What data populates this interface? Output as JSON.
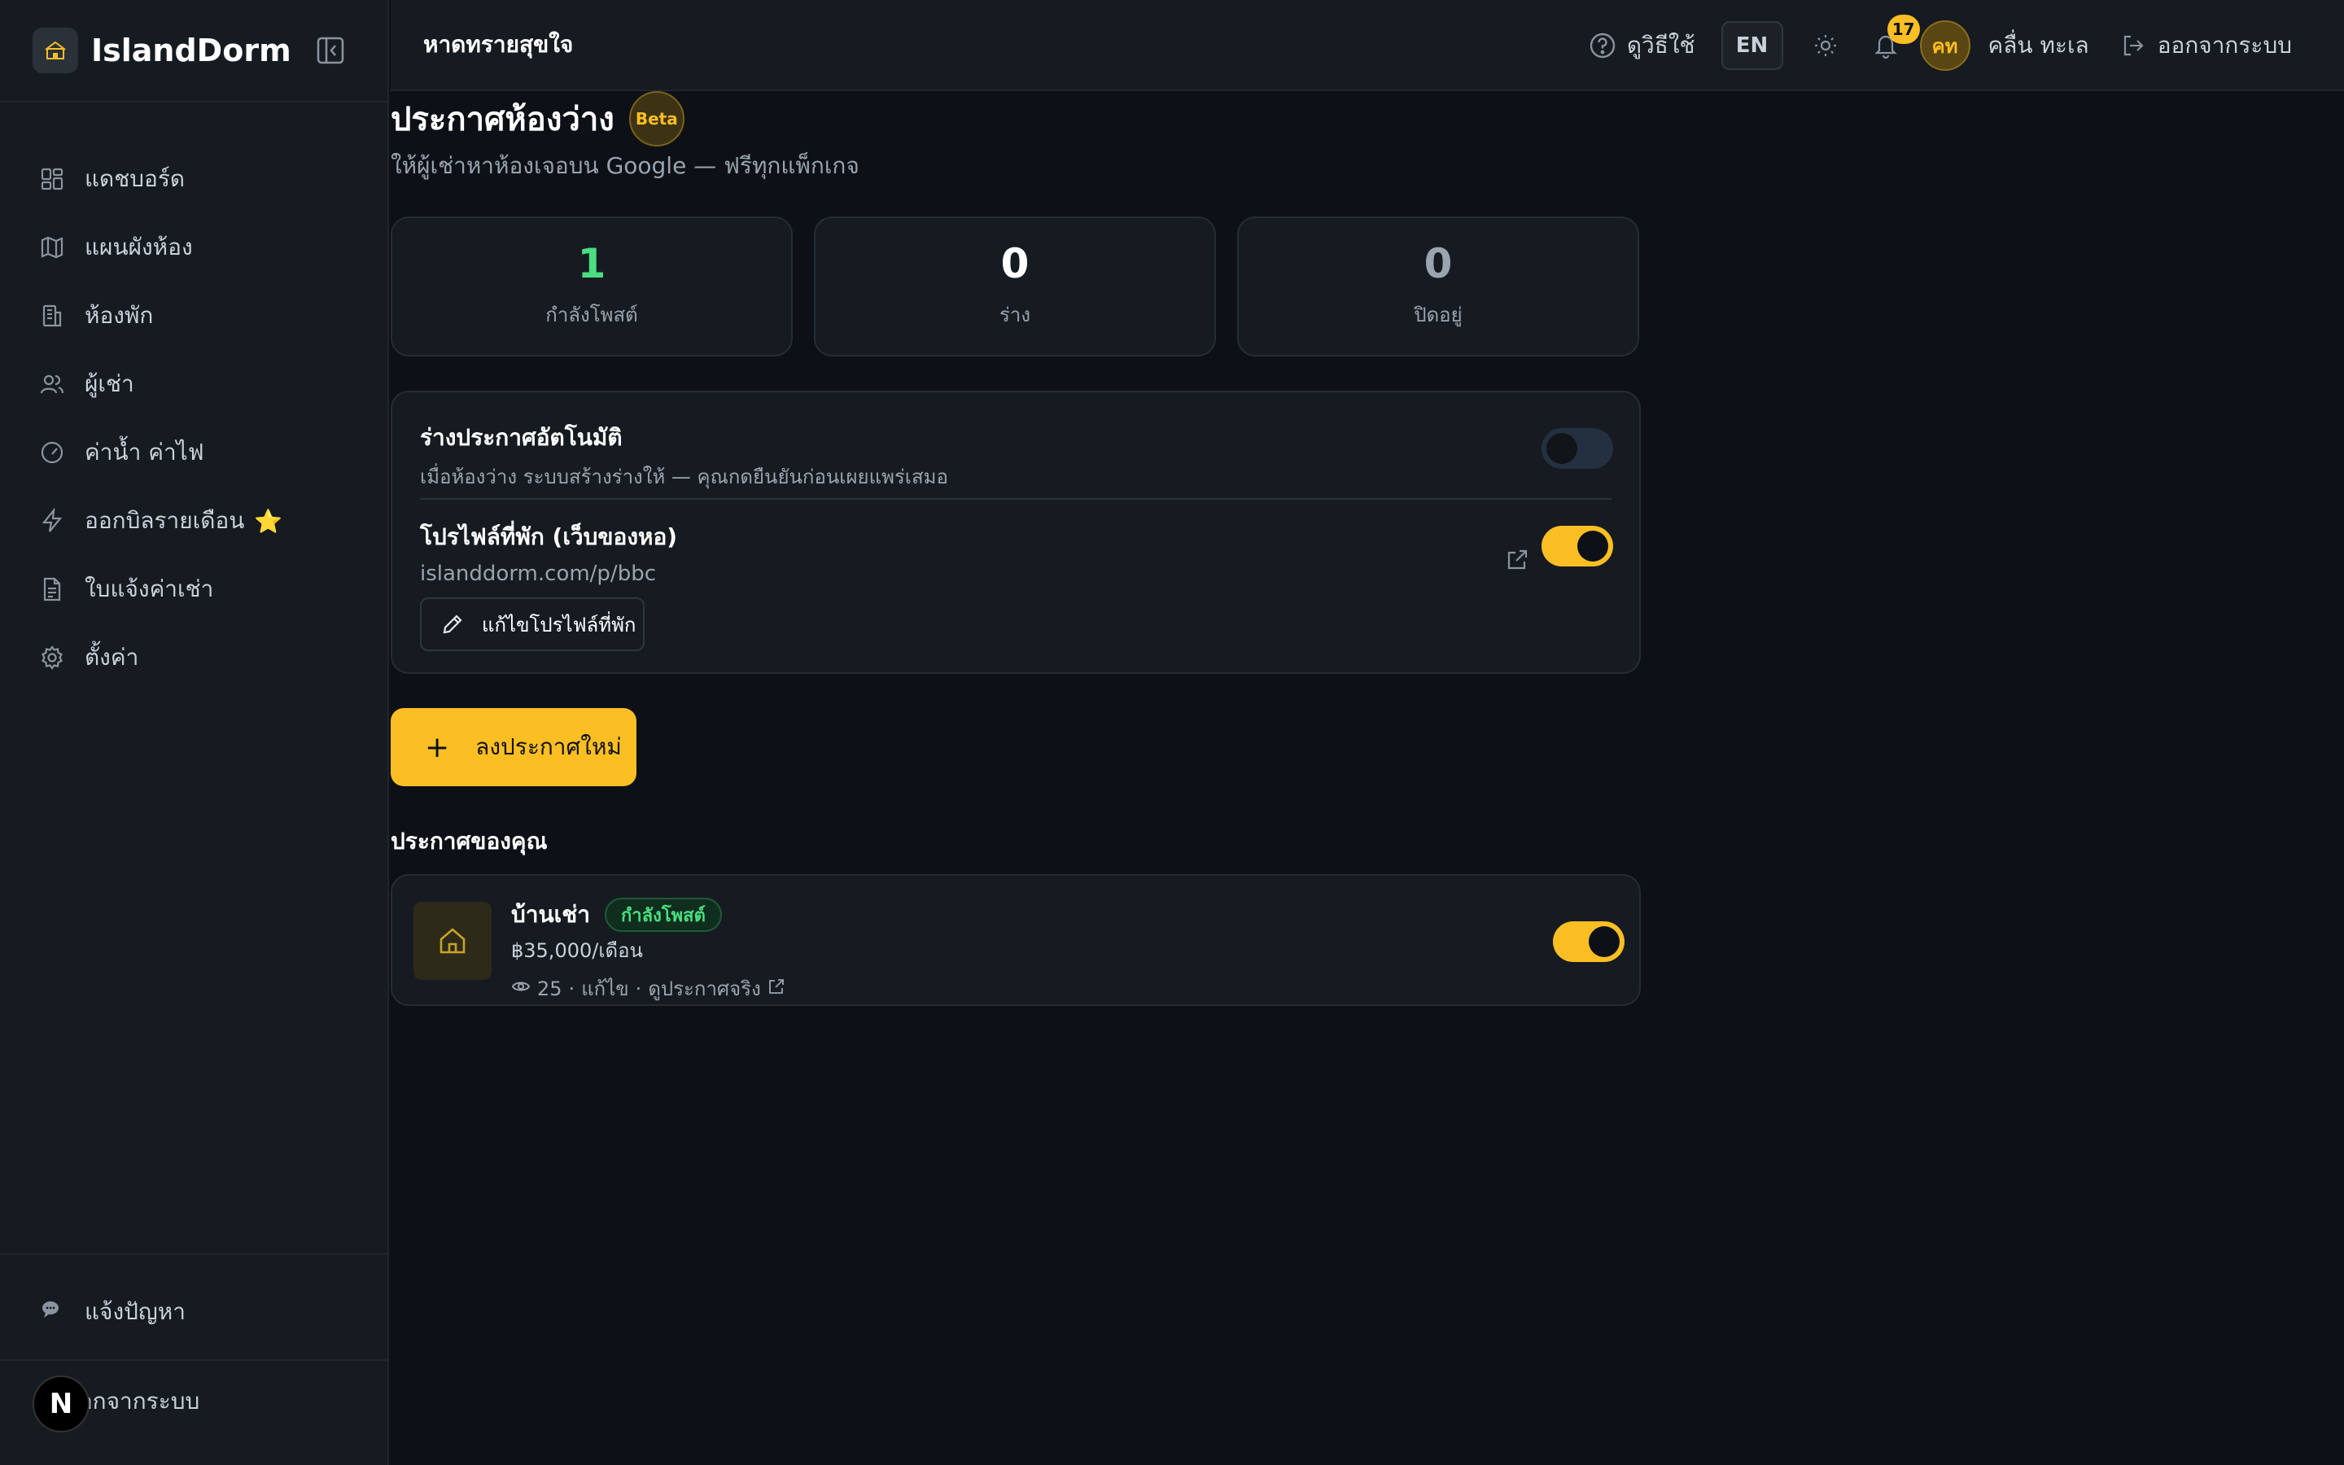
{
  "app": {
    "name": "IslandDorm"
  },
  "sidebar": {
    "items": [
      {
        "label": "แดชบอร์ด",
        "icon": "dashboard-icon"
      },
      {
        "label": "แผนผังห้อง",
        "icon": "map-icon"
      },
      {
        "label": "ห้องพัก",
        "icon": "building-icon"
      },
      {
        "label": "ผู้เช่า",
        "icon": "users-icon"
      },
      {
        "label": "ค่าน้ำ ค่าไฟ",
        "icon": "gauge-icon"
      },
      {
        "label": "ออกบิลรายเดือน",
        "icon": "lightning-icon"
      },
      {
        "label": "ใบแจ้งค่าเช่า",
        "icon": "document-icon"
      },
      {
        "label": "ตั้งค่า",
        "icon": "gear-icon"
      }
    ],
    "star": "⭐",
    "report_label": "แจ้งปัญหา",
    "logout_label": "ออกจากระบบ",
    "next_badge": "N"
  },
  "topbar": {
    "dorm_name": "หาดทรายสุขใจ",
    "help_label": "ดูวิธีใช้",
    "lang_label": "EN",
    "notification_count": "17",
    "avatar_initials": "คท",
    "user_name": "คลื่น ทะเล",
    "logout_label": "ออกจากระบบ"
  },
  "page": {
    "title": "ประกาศห้องว่าง",
    "beta_label": "Beta",
    "subtitle": "ให้ผู้เช่าหาห้องเจอบน Google — ฟรีทุกแพ็กเกจ"
  },
  "stats": [
    {
      "value": "1",
      "label": "กำลังโพสต์",
      "color": "#4ade80"
    },
    {
      "value": "0",
      "label": "ร่าง",
      "color": "#ffffff"
    },
    {
      "value": "0",
      "label": "ปิดอยู่",
      "color": "#9aa4af"
    }
  ],
  "settings": {
    "auto_draft_title": "ร่างประกาศอัตโนมัติ",
    "auto_draft_desc": "เมื่อห้องว่าง ระบบสร้างร่างให้ — คุณกดยืนยันก่อนเผยแพร่เสมอ",
    "auto_draft_on": false,
    "profile_title": "โปรไฟล์ที่พัก (เว็บของหอ)",
    "profile_url": "islanddorm.com/p/bbc",
    "profile_on": true,
    "edit_profile_label": "แก้ไขโปรไฟล์ที่พัก"
  },
  "new_listing_label": "ลงประกาศใหม่",
  "listings_section_title": "ประกาศของคุณ",
  "listings": [
    {
      "name": "บ้านเช่า",
      "status": "กำลังโพสต์",
      "price": "฿35,000/เดือน",
      "views": "25",
      "edit_label": "แก้ไข",
      "view_label": "ดูประกาศจริง",
      "separator": "·",
      "active": true
    }
  ],
  "colors": {
    "accent": "#fbbf24",
    "success": "#4ade80",
    "background": "#0d1117",
    "surface": "#161b22"
  }
}
